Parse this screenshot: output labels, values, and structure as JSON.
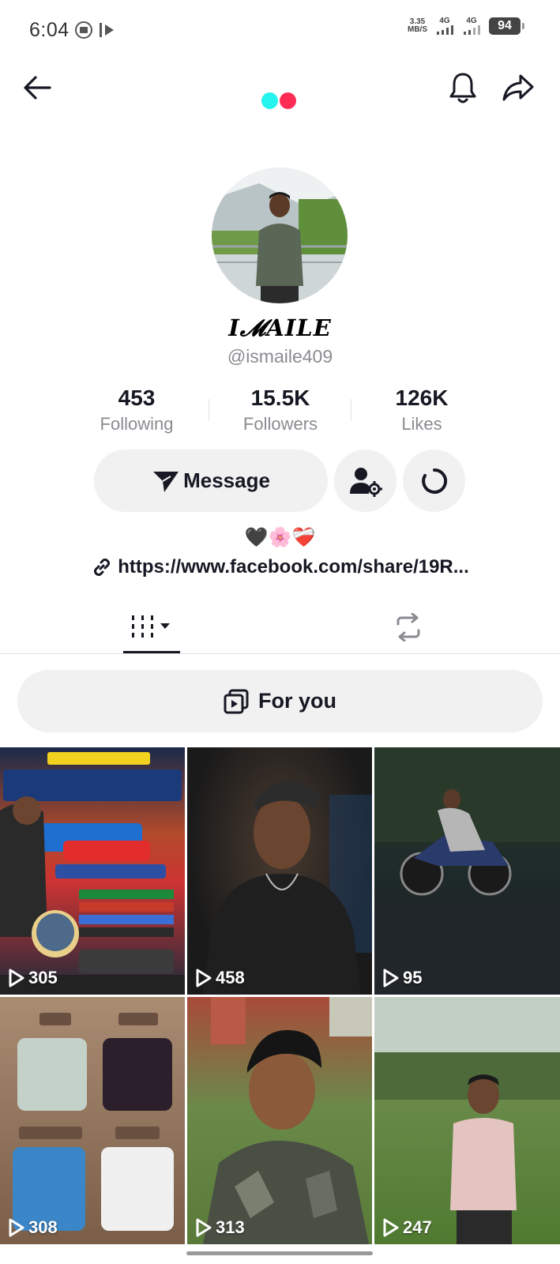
{
  "status_bar": {
    "time": "6:04",
    "net_speed_value": "3.35",
    "net_speed_unit": "MB/S",
    "signal_1": "4G",
    "signal_2": "4G",
    "battery": "94"
  },
  "colors": {
    "accent_cyan": "#25f4ee",
    "accent_red": "#fe2c55",
    "text_primary": "#161823",
    "text_secondary": "#8a8b91",
    "button_bg": "#f1f1f2"
  },
  "header": {
    "back_icon": "arrow-left-icon",
    "bell_icon": "bell-icon",
    "share_icon": "share-icon"
  },
  "profile": {
    "display_name": "I𝓜AILE",
    "username": "@ismaile409",
    "stats": [
      {
        "value": "453",
        "label": "Following"
      },
      {
        "value": "15.5K",
        "label": "Followers"
      },
      {
        "value": "126K",
        "label": "Likes"
      }
    ],
    "message_label": "Message",
    "bio_emojis": "🖤🌸❤️‍🩹",
    "link": "https://www.facebook.com/share/19R..."
  },
  "tabs": {
    "videos_icon": "grid-icon",
    "reposts_icon": "repost-icon"
  },
  "for_you": {
    "label": "For you"
  },
  "videos": [
    {
      "views": "305"
    },
    {
      "views": "458"
    },
    {
      "views": "95"
    },
    {
      "views": "308"
    },
    {
      "views": "313"
    },
    {
      "views": "247"
    }
  ]
}
